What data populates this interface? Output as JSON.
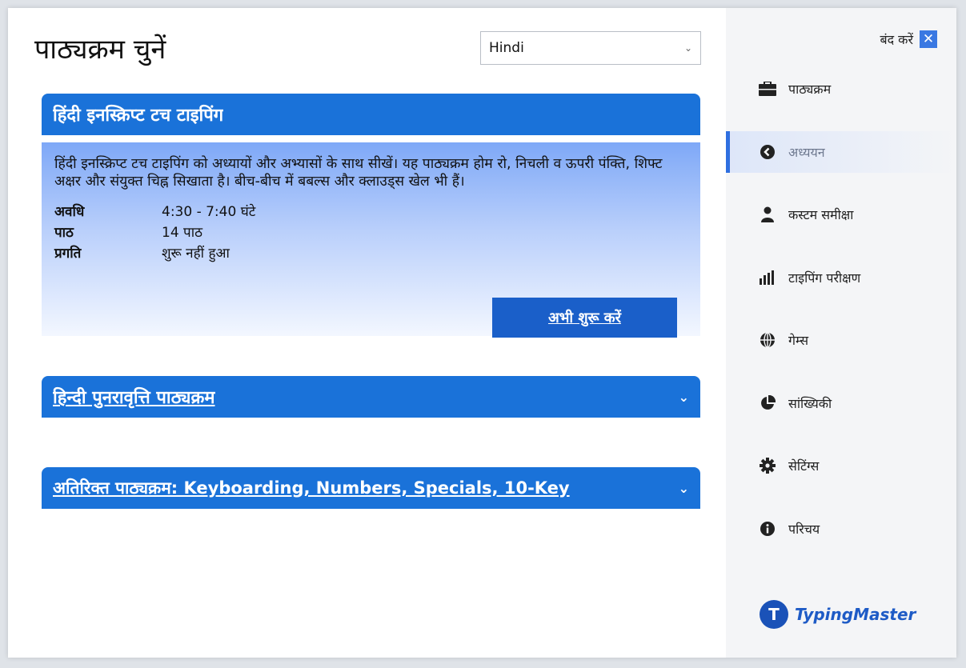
{
  "main": {
    "title": "पाठ्यक्रम चुनें",
    "language": {
      "selected": "Hindi"
    },
    "course_primary": {
      "title": "हिंदी इनस्क्रिप्ट टच टाइपिंग",
      "description": "हिंदी इनस्क्रिप्ट टच टाइपिंग को अध्यायों और अभ्यासों के साथ सीखें। यह पाठ्यक्रम होम रो, निचली व ऊपरी पंक्ति, शिफ्ट अक्षर और संयुक्त चिह्न सिखाता है। बीच-बीच में बबल्स और क्लाउड्स खेल भी हैं।",
      "meta": [
        {
          "label": "अवधि",
          "value": "4:30 - 7:40 घंटे"
        },
        {
          "label": "पाठ",
          "value": "14 पाठ"
        },
        {
          "label": "प्रगति",
          "value": "शुरू नहीं हुआ"
        }
      ],
      "start_label": "अभी शुरू करें"
    },
    "course_revision": {
      "title": "हिन्दी पुनरावृत्ति पाठ्यक्रम"
    },
    "course_additional": {
      "title": "अतिरिक्त पाठ्यक्रम: Keyboarding, Numbers, Specials, 10-Key"
    }
  },
  "sidebar": {
    "close_label": "बंद करें",
    "items": [
      {
        "label": "पाठ्यक्रम",
        "icon": "briefcase-icon",
        "active": false
      },
      {
        "label": "अध्ययन",
        "icon": "arrow-left-circle-icon",
        "active": true
      },
      {
        "label": "कस्टम समीक्षा",
        "icon": "user-icon",
        "active": false
      },
      {
        "label": "टाइपिंग परीक्षण",
        "icon": "bar-chart-icon",
        "active": false
      },
      {
        "label": "गेम्स",
        "icon": "globe-icon",
        "active": false
      },
      {
        "label": "सांख्यिकी",
        "icon": "pie-chart-icon",
        "active": false
      },
      {
        "label": "सेटिंग्स",
        "icon": "gear-icon",
        "active": false
      },
      {
        "label": "परिचय",
        "icon": "info-icon",
        "active": false
      }
    ],
    "logo_text": "TypingMaster"
  },
  "colors": {
    "accent": "#1a72d9",
    "button": "#1a5fc9",
    "active_indicator": "#2f6fe0"
  }
}
